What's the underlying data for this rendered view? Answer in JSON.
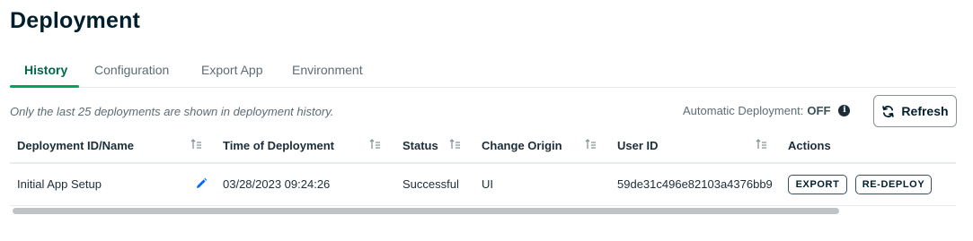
{
  "page": {
    "title": "Deployment"
  },
  "tabs": [
    {
      "label": "History",
      "active": true
    },
    {
      "label": "Configuration",
      "active": false
    },
    {
      "label": "Export App",
      "active": false
    },
    {
      "label": "Environment",
      "active": false
    }
  ],
  "info_note": "Only the last 25 deployments are shown in deployment history.",
  "auto_deploy": {
    "label": "Automatic Deployment:",
    "value": "OFF",
    "icon": "info-icon"
  },
  "refresh": {
    "label": "Refresh",
    "icon": "refresh-icon"
  },
  "table": {
    "columns": [
      {
        "label": "Deployment ID/Name",
        "sortable": true
      },
      {
        "label": "Time of Deployment",
        "sortable": true
      },
      {
        "label": "Status",
        "sortable": true
      },
      {
        "label": "Change Origin",
        "sortable": true
      },
      {
        "label": "User ID",
        "sortable": true
      },
      {
        "label": "Actions",
        "sortable": false
      }
    ],
    "rows": [
      {
        "name": "Initial App Setup",
        "time": "03/28/2023 09:24:26",
        "status": "Successful",
        "origin": "UI",
        "user_id": "59de31c496e82103a4376bb9",
        "actions": [
          "EXPORT",
          "RE-DEPLOY"
        ]
      }
    ]
  },
  "colors": {
    "accent_green": "#00a35c",
    "active_tab_text": "#00684a",
    "title": "#001e2b"
  }
}
